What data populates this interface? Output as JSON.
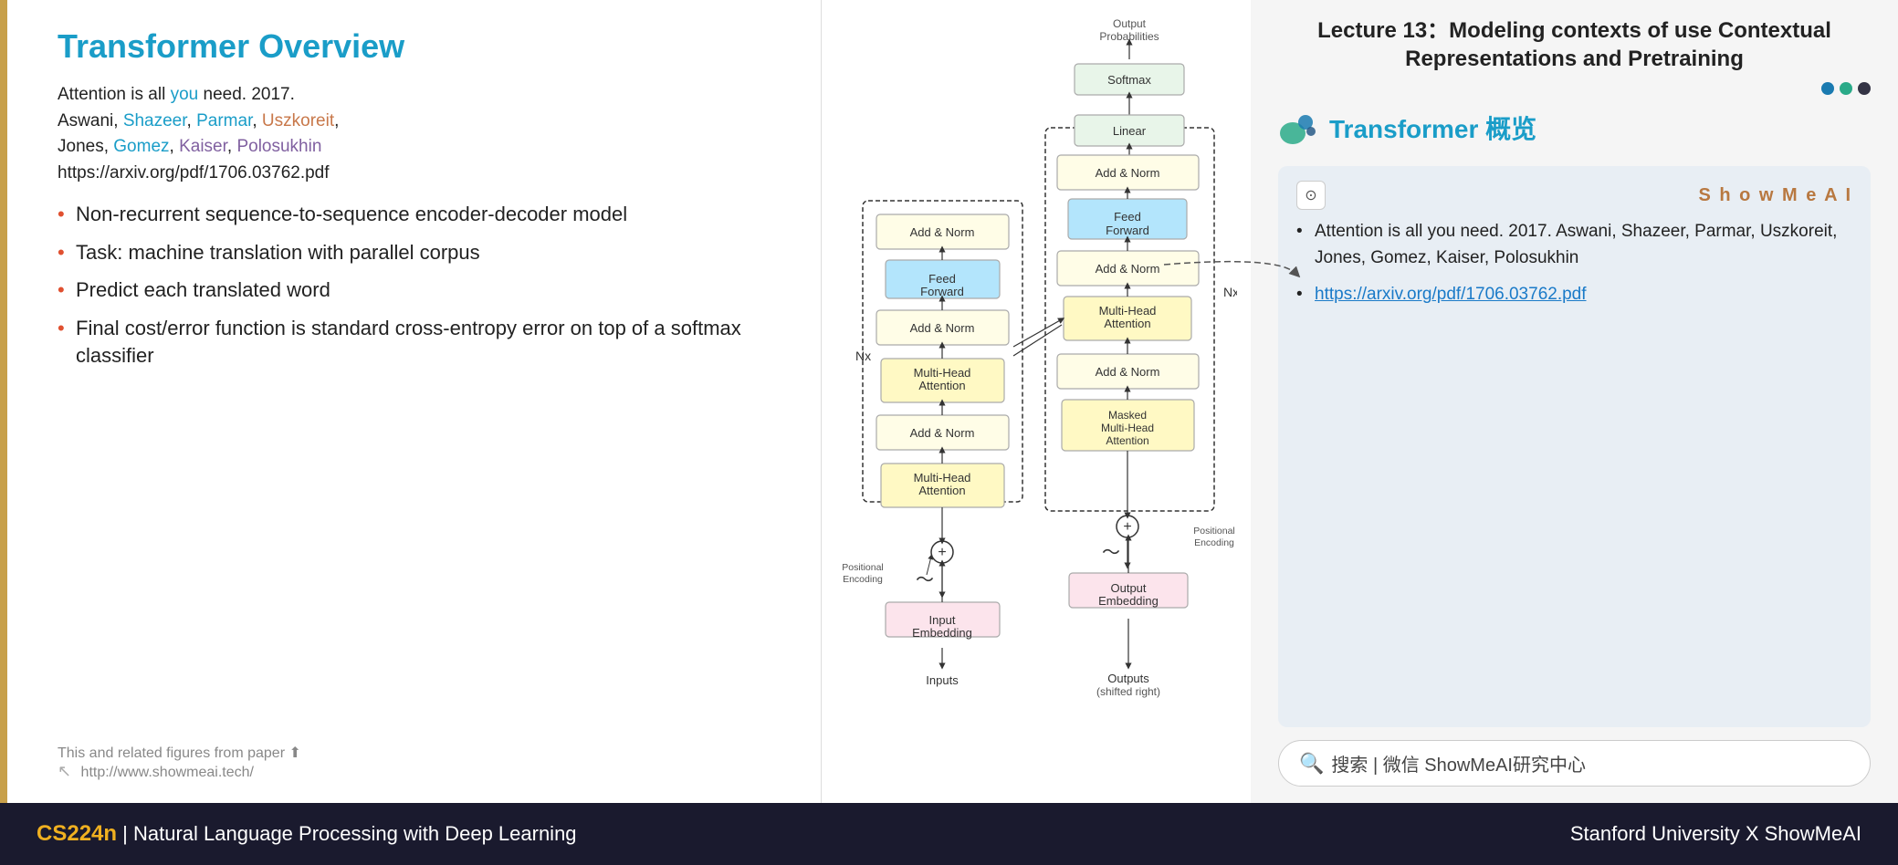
{
  "lecture": {
    "title_line1": "Lecture 13：Modeling contexts of use Contextual",
    "title_line2": "Representations and Pretraining"
  },
  "slide": {
    "title": "Transformer Overview",
    "body_text_line1": "Attention is all you need. 2017.",
    "body_text_line2": "Aswani, Shazeer, Parmar, Uszkoreit,",
    "body_text_line3": "Jones, Gomez, Kaiser, Polosukhin",
    "body_text_url": "https://arxiv.org/pdf/1706.03762.pdf",
    "bullets": [
      "Non-recurrent sequence-to-sequence encoder-decoder model",
      "Task: machine translation with parallel corpus",
      "Predict each translated word",
      "Final cost/error function is standard cross-entropy error on top of a softmax classifier"
    ],
    "footer_note": "This and related figures from paper ⬆",
    "footer_link": "http://www.showmeai.tech/"
  },
  "diagram": {
    "output_probs": "Output\nProbabilities",
    "softmax": "Softmax",
    "linear": "Linear",
    "add_norm1_enc": "Add & Norm",
    "feed_forward_enc": "Feed\nForward",
    "add_norm2_enc": "Add & Norm",
    "multihead_enc": "Multi-Head\nAttention",
    "nx_enc": "Nx",
    "add_norm_bot_enc": "Add & Norm",
    "multihead_bot_enc": "Multi-Head\nAttention",
    "pos_enc_enc": "Positional\nEncoding",
    "input_emb": "Input\nEmbedding",
    "inputs": "Inputs",
    "add_norm1_dec": "Add & Norm",
    "feed_forward_dec": "Feed\nForward",
    "add_norm2_dec": "Add & Norm",
    "multihead_dec": "Multi-Head\nAttention",
    "nx_dec": "Nx",
    "add_norm3_dec": "Add & Norm",
    "masked_multihead": "Masked\nMulti-Head\nAttention",
    "pos_enc_dec": "Positional\nEncoding",
    "output_emb": "Output\nEmbedding",
    "outputs": "Outputs\n(shifted right)"
  },
  "right_panel": {
    "transformer_title": "Transformer 概览",
    "showmeai_brand": "S h o w M e A I",
    "card_bullet1": "Attention is all you need. 2017. Aswani, Shazeer, Parmar,  Uszkoreit,  Jones,  Gomez,  Kaiser, Polosukhin",
    "card_bullet2_link": "https://arxiv.org/pdf/1706.03762.pdf",
    "search_placeholder": "搜索 | 微信 ShowMeAI研究中心"
  },
  "bottom_bar": {
    "cs_label": "CS224n",
    "separator": "|",
    "course_name": "Natural Language Processing with Deep Learning",
    "right_text": "Stanford University X ShowMeAI"
  }
}
